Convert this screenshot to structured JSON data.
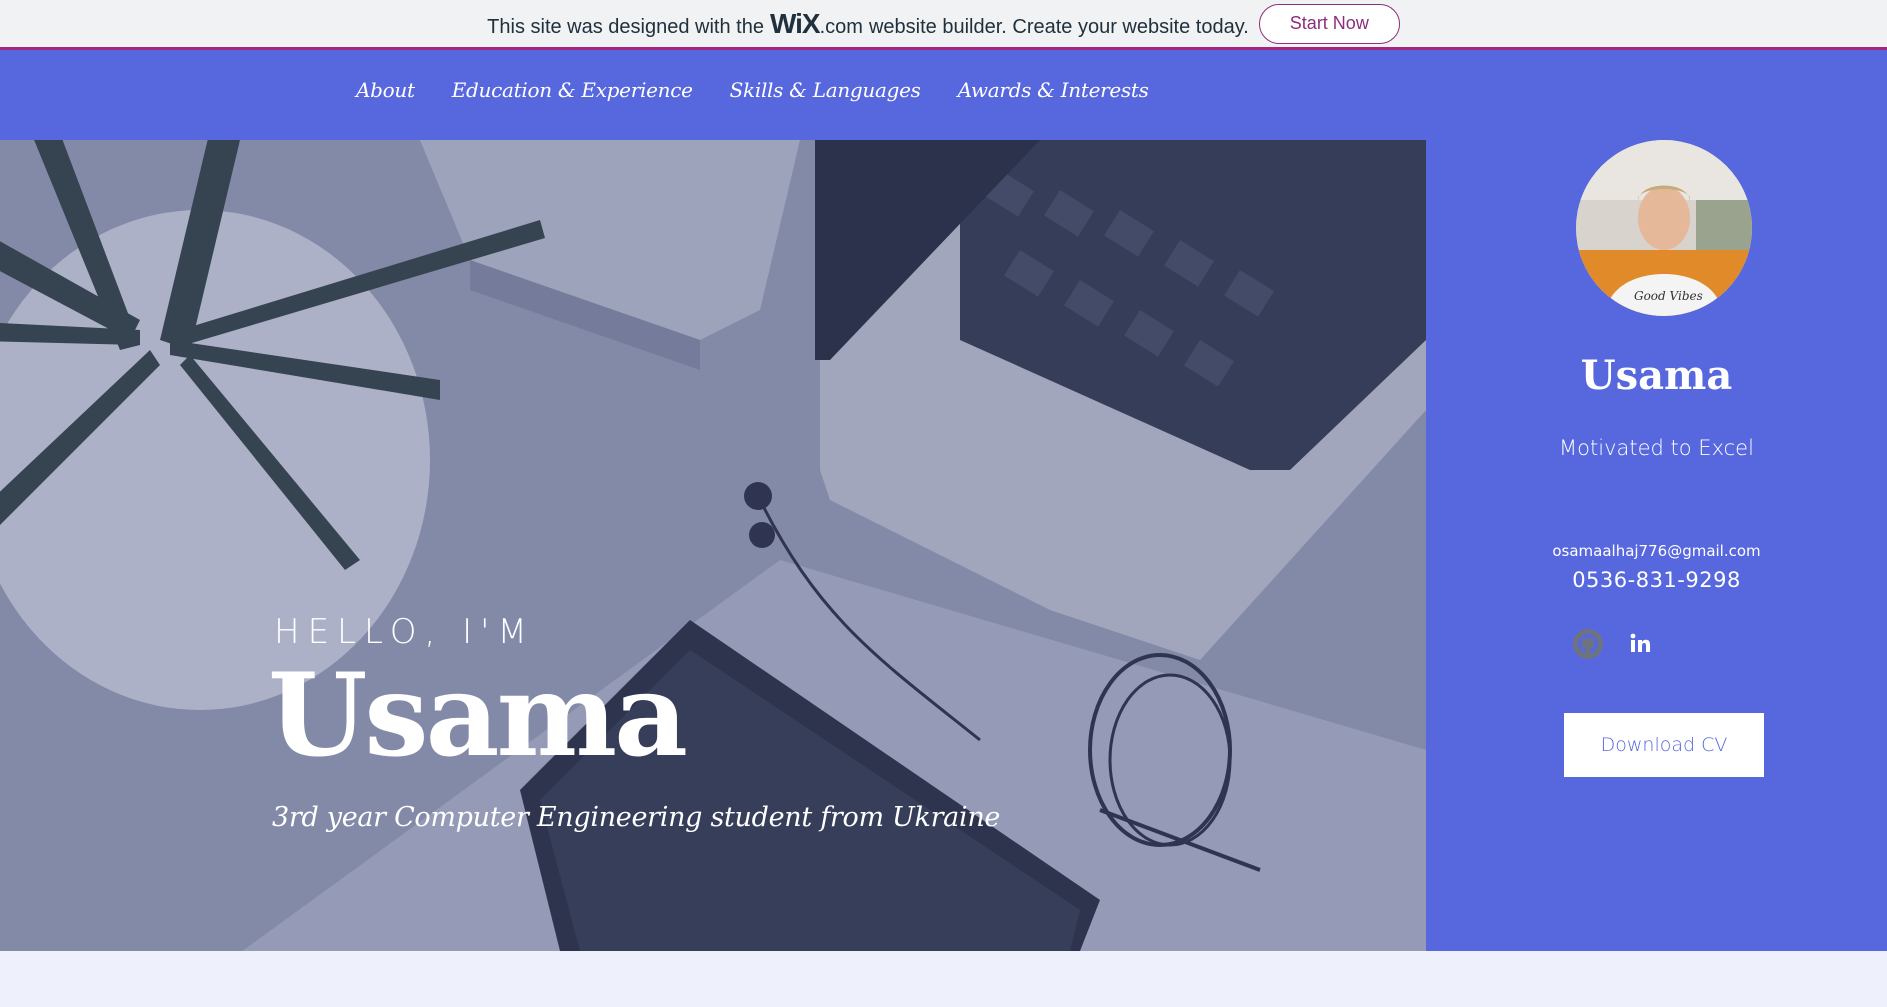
{
  "banner": {
    "text_before": "This site was designed with the",
    "logo": "WiX",
    "logo_suffix": ".com",
    "text_after": "website builder. Create your website today.",
    "cta": "Start Now",
    "accent_color": "#a3277f"
  },
  "nav": {
    "items": [
      {
        "label": "About"
      },
      {
        "label": "Education & Experience"
      },
      {
        "label": "Skills & Languages"
      },
      {
        "label": "Awards & Interests"
      }
    ]
  },
  "hero": {
    "greeting": "HELLO, I'M",
    "name": "Usama",
    "subtitle": "3rd year Computer Engineering student from Ukraine"
  },
  "sidebar": {
    "name": "Usama",
    "tagline": "Motivated to Excel",
    "email": "osamaalhaj776@gmail.com",
    "phone": "0536-831-9298",
    "social": [
      {
        "icon": "github-icon"
      },
      {
        "icon": "linkedin-icon"
      }
    ],
    "download_label": "Download CV",
    "brand_color": "#5767de"
  }
}
